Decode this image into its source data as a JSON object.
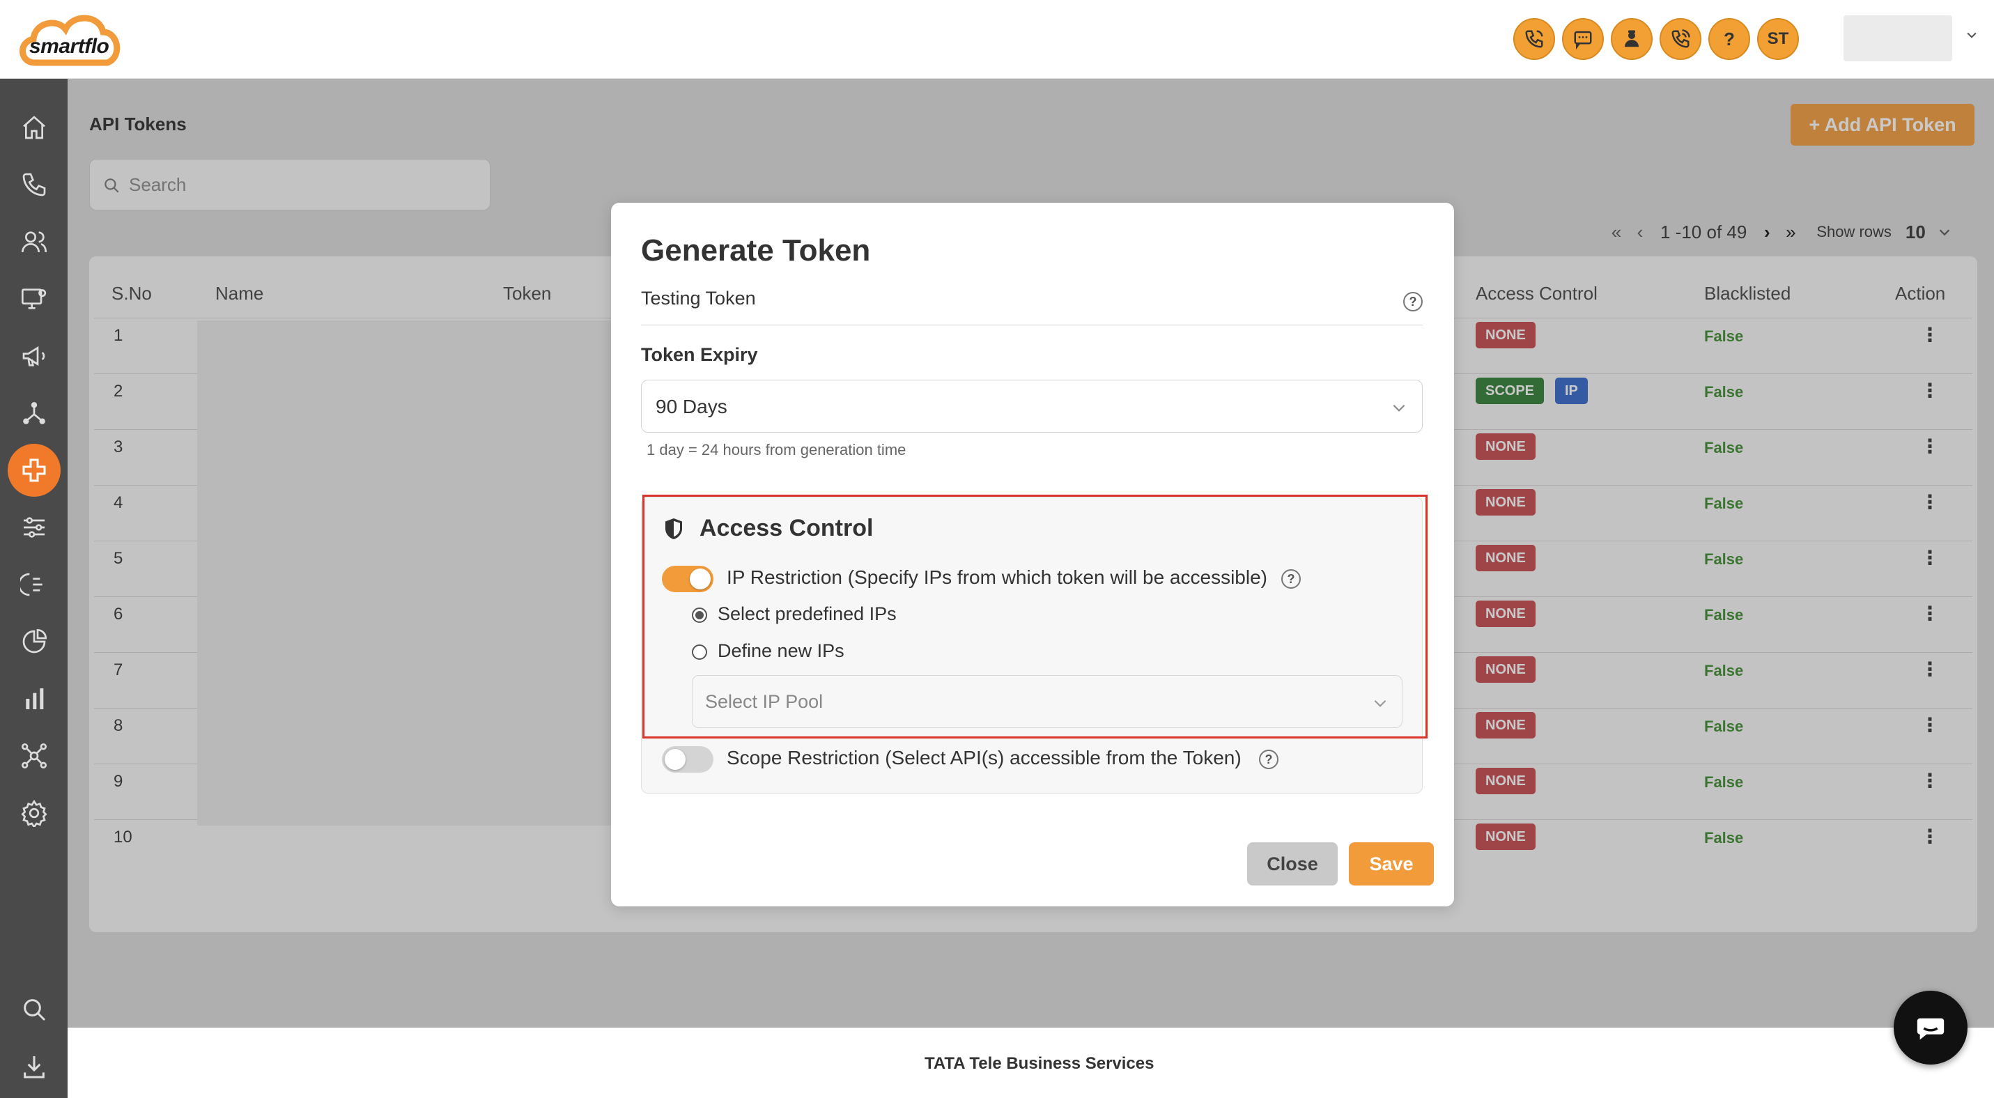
{
  "brand": {
    "logo_text": "smartflo",
    "accent": "#f29b3b"
  },
  "header": {
    "icons": [
      "phone-icon",
      "sms-icon",
      "agent-icon",
      "call-icon",
      "help-icon"
    ],
    "help_glyph": "?",
    "user_initials": "ST"
  },
  "sidebar": {
    "items": [
      "home-icon",
      "phone-icon",
      "users-icon",
      "monitor-settings-icon",
      "megaphone-icon",
      "network-icon",
      "api-icon",
      "sliders-icon",
      "ivr-icon",
      "pie-chart-icon",
      "bar-chart-icon",
      "integrations-icon",
      "settings-icon",
      "search-icon",
      "download-icon"
    ],
    "active": "api-icon"
  },
  "page": {
    "title": "API Tokens",
    "add_button": "+ Add API Token",
    "search_placeholder": "Search"
  },
  "pagination": {
    "first": "«",
    "prev": "‹",
    "range": "1 -10 of 49",
    "next": "›",
    "last": "»",
    "rows_label": "Show rows",
    "rows_value": "10"
  },
  "table": {
    "headers": {
      "sno": "S.No",
      "name": "Name",
      "token": "Token",
      "access": "Access Control",
      "blacklisted": "Blacklisted",
      "action": "Action"
    },
    "rows": [
      {
        "sno": "1",
        "access": [
          "NONE"
        ],
        "blacklisted": "False"
      },
      {
        "sno": "2",
        "access": [
          "SCOPE",
          "IP"
        ],
        "blacklisted": "False"
      },
      {
        "sno": "3",
        "access": [
          "NONE"
        ],
        "blacklisted": "False"
      },
      {
        "sno": "4",
        "access": [
          "NONE"
        ],
        "blacklisted": "False"
      },
      {
        "sno": "5",
        "access": [
          "NONE"
        ],
        "blacklisted": "False"
      },
      {
        "sno": "6",
        "access": [
          "NONE"
        ],
        "blacklisted": "False"
      },
      {
        "sno": "7",
        "access": [
          "NONE"
        ],
        "blacklisted": "False"
      },
      {
        "sno": "8",
        "access": [
          "NONE"
        ],
        "blacklisted": "False"
      },
      {
        "sno": "9",
        "access": [
          "NONE"
        ],
        "blacklisted": "False"
      },
      {
        "sno": "10",
        "access": [
          "NONE"
        ],
        "blacklisted": "False"
      }
    ],
    "action_glyph": "⋮"
  },
  "modal": {
    "title": "Generate Token",
    "token_name": "Testing Token",
    "help_glyph": "?",
    "expiry_label": "Token Expiry",
    "expiry_value": "90 Days",
    "expiry_note": "1 day = 24 hours from generation time",
    "access_control": {
      "title": "Access Control",
      "ip_restriction_label": "IP Restriction (Specify IPs from which token will be accessible)",
      "ip_restriction_enabled": true,
      "radio_predefined": "Select predefined IPs",
      "radio_define_new": "Define new IPs",
      "selected_radio": "predefined",
      "ip_pool_placeholder": "Select IP Pool",
      "scope_restriction_label": "Scope Restriction (Select API(s) accessible from the Token)",
      "scope_restriction_enabled": false
    },
    "close_button": "Close",
    "save_button": "Save"
  },
  "footer": {
    "text": "TATA Tele Business Services"
  }
}
